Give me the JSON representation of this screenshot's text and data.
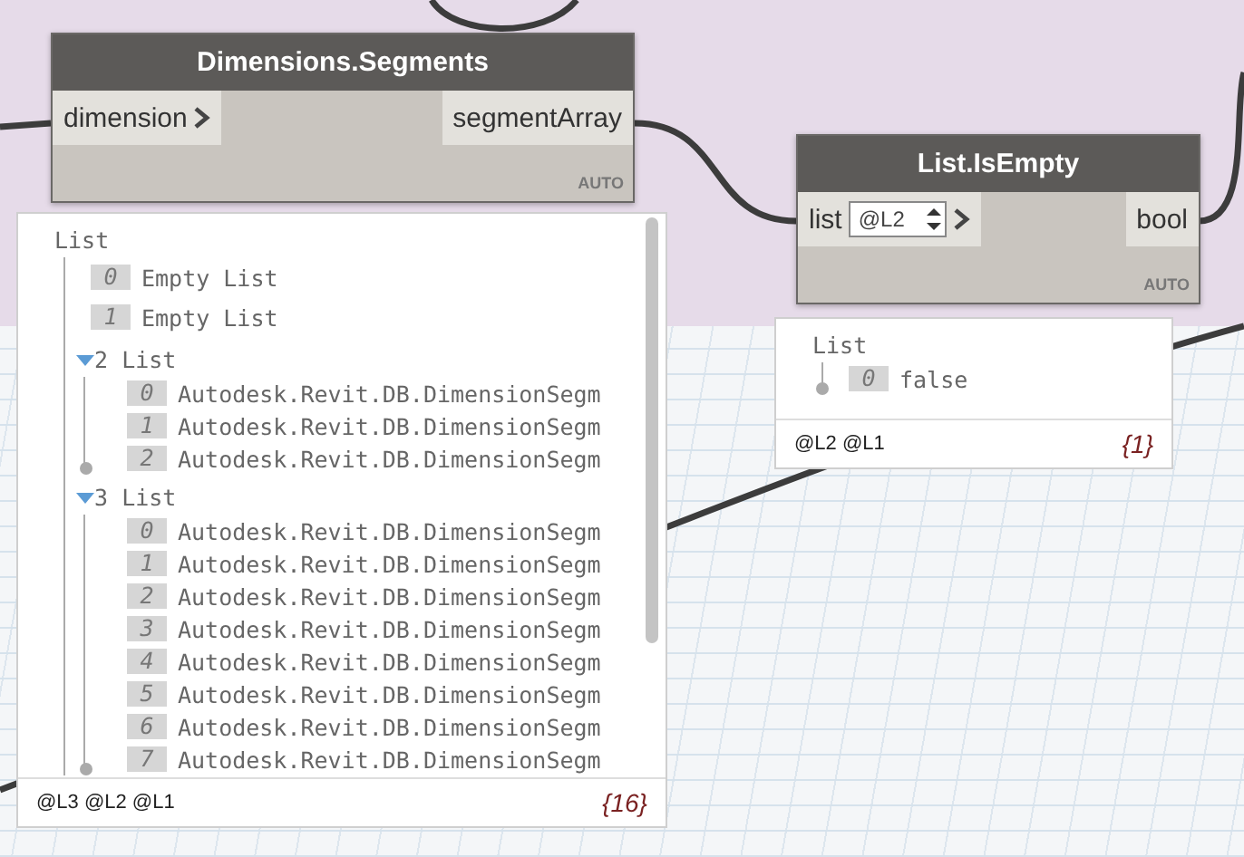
{
  "nodes": [
    {
      "title": "Dimensions.Segments",
      "inputs": [
        {
          "name": "dimension"
        }
      ],
      "outputs": [
        {
          "name": "segmentArray"
        }
      ],
      "footer": "AUTO",
      "preview": {
        "root_label": "List",
        "items": [
          {
            "kind": "item",
            "index": "0",
            "text": "Empty List"
          },
          {
            "kind": "item",
            "index": "1",
            "text": "Empty List"
          },
          {
            "kind": "list",
            "index": "2",
            "label": "List",
            "expanded": true,
            "children": [
              {
                "kind": "item",
                "index": "0",
                "text": "Autodesk.Revit.DB.DimensionSegm"
              },
              {
                "kind": "item",
                "index": "1",
                "text": "Autodesk.Revit.DB.DimensionSegm"
              },
              {
                "kind": "item",
                "index": "2",
                "text": "Autodesk.Revit.DB.DimensionSegm"
              }
            ]
          },
          {
            "kind": "list",
            "index": "3",
            "label": "List",
            "expanded": true,
            "children": [
              {
                "kind": "item",
                "index": "0",
                "text": "Autodesk.Revit.DB.DimensionSegm"
              },
              {
                "kind": "item",
                "index": "1",
                "text": "Autodesk.Revit.DB.DimensionSegm"
              },
              {
                "kind": "item",
                "index": "2",
                "text": "Autodesk.Revit.DB.DimensionSegm"
              },
              {
                "kind": "item",
                "index": "3",
                "text": "Autodesk.Revit.DB.DimensionSegm"
              },
              {
                "kind": "item",
                "index": "4",
                "text": "Autodesk.Revit.DB.DimensionSegm"
              },
              {
                "kind": "item",
                "index": "5",
                "text": "Autodesk.Revit.DB.DimensionSegm"
              },
              {
                "kind": "item",
                "index": "6",
                "text": "Autodesk.Revit.DB.DimensionSegm"
              },
              {
                "kind": "item",
                "index": "7",
                "text": "Autodesk.Revit.DB.DimensionSegm"
              }
            ]
          }
        ],
        "levels": [
          "@L3",
          "@L2",
          "@L1"
        ],
        "count": "{16}"
      }
    },
    {
      "title": "List.IsEmpty",
      "inputs": [
        {
          "name": "list",
          "level_spec": "@L2"
        }
      ],
      "outputs": [
        {
          "name": "bool"
        }
      ],
      "footer": "AUTO",
      "preview": {
        "root_label": "List",
        "items": [
          {
            "kind": "item",
            "index": "0",
            "text": "false"
          }
        ],
        "levels": [
          "@L2",
          "@L1"
        ],
        "count": "{1}"
      }
    }
  ]
}
